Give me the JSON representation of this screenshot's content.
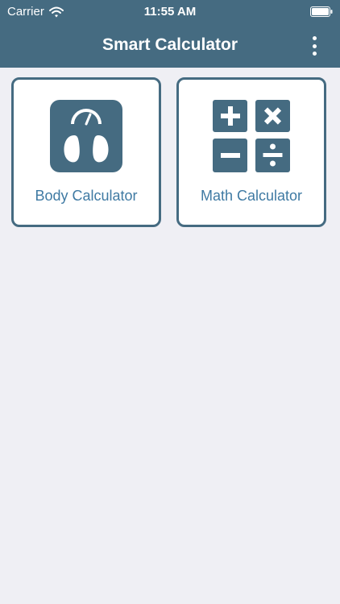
{
  "status_bar": {
    "carrier": "Carrier",
    "time": "11:55 AM",
    "icons": [
      "wifi-icon",
      "battery-icon"
    ]
  },
  "nav": {
    "title": "Smart Calculator",
    "menu_icon": "more-vertical-icon"
  },
  "tiles": [
    {
      "label": "Body Calculator",
      "icon": "bathroom-scale-icon"
    },
    {
      "label": "Math Calculator",
      "icon": "math-operators-icon"
    }
  ],
  "colors": {
    "brand": "#456b81",
    "label": "#3f7aa3",
    "background": "#efeff4",
    "tile_background": "#ffffff"
  }
}
